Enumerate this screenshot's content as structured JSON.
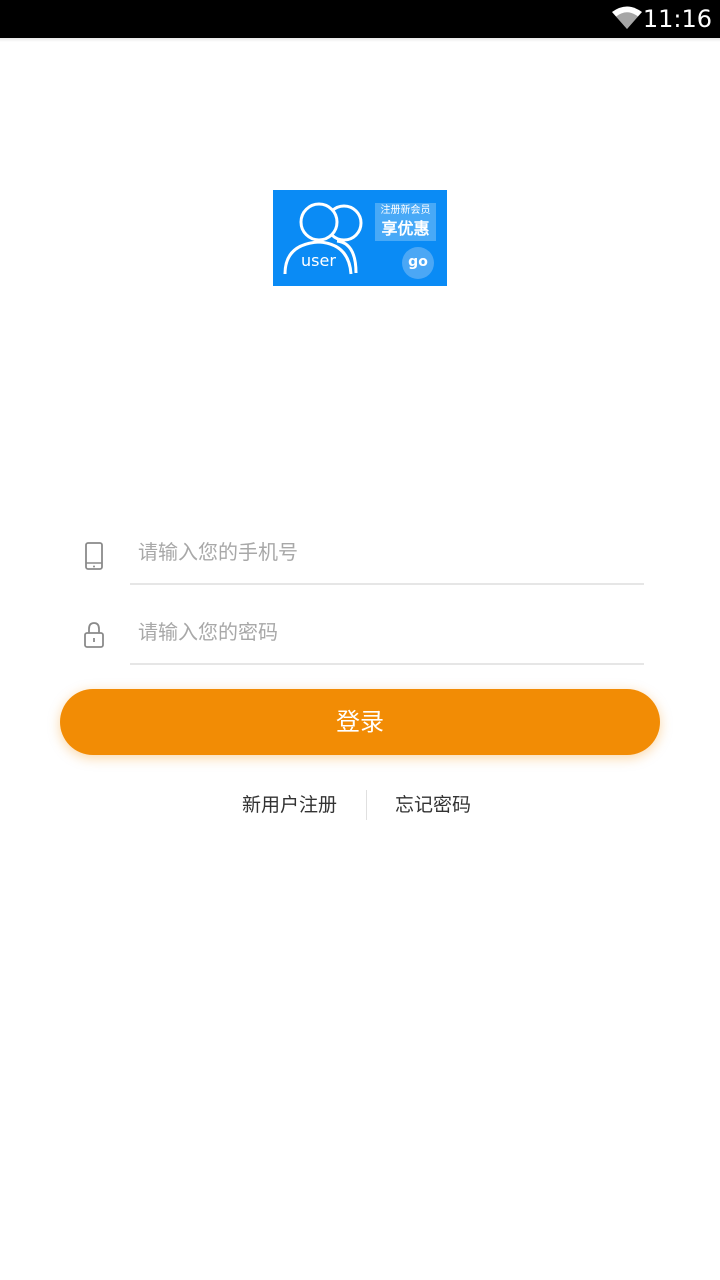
{
  "status_bar": {
    "time": "11:16",
    "icons": [
      "wifi-icon"
    ]
  },
  "banner": {
    "tag_line1": "注册新会员",
    "tag_line2": "享优惠",
    "user_text": "user",
    "go_text": "go",
    "colors": {
      "background": "#0a8bf5",
      "tag": "#48a9f7"
    }
  },
  "form": {
    "phone": {
      "placeholder": "请输入您的手机号",
      "value": "",
      "icon": "phone-icon"
    },
    "password": {
      "placeholder": "请输入您的密码",
      "value": "",
      "icon": "lock-icon"
    },
    "login_label": "登录"
  },
  "links": {
    "register": "新用户注册",
    "forgot": "忘记密码"
  },
  "colors": {
    "accent": "#f28c05",
    "text": "#333333",
    "placeholder": "#a8a8a8"
  }
}
